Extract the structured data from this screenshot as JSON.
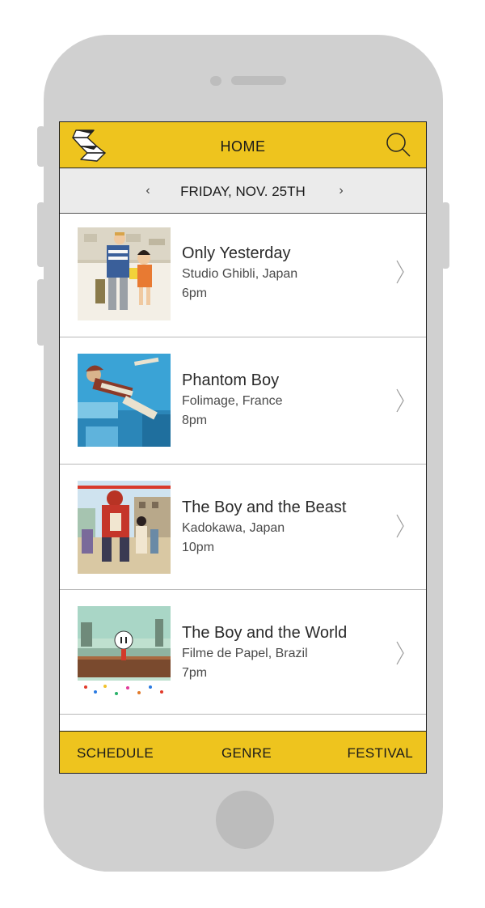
{
  "header": {
    "title": "HOME",
    "logo_icon": "origami-logo-icon",
    "search_icon": "search-icon"
  },
  "date_nav": {
    "prev": "‹",
    "date": "FRIDAY, NOV. 25TH",
    "next": "›"
  },
  "films": [
    {
      "title": "Only Yesterday",
      "studio": "Studio Ghibli, Japan",
      "time": "6pm"
    },
    {
      "title": "Phantom Boy",
      "studio": "Folimage, France",
      "time": "8pm"
    },
    {
      "title": "The Boy and the Beast",
      "studio": "Kadokawa, Japan",
      "time": "10pm"
    },
    {
      "title": "The Boy and the World",
      "studio": "Filme de Papel, Brazil",
      "time": "7pm"
    }
  ],
  "tabs": {
    "schedule": "SCHEDULE",
    "genre": "GENRE",
    "festival": "FESTIVAL"
  },
  "colors": {
    "accent": "#eec41e",
    "date_bar": "#ebebeb",
    "phone": "#d0d0d0"
  }
}
